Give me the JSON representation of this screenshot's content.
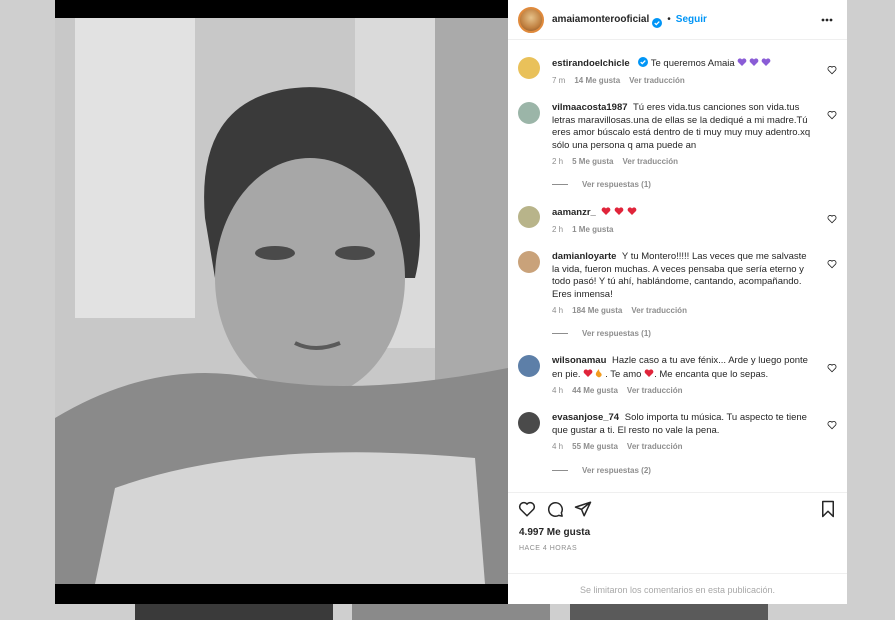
{
  "post": {
    "username": "amaiamonterooficial",
    "follow_label": "Seguir",
    "likes": "4.997 Me gusta",
    "timestamp": "HACE 4 HORAS",
    "comments_limited": "Se limitaron los comentarios en esta publicación."
  },
  "comments": [
    {
      "user": "estirandoelchicle",
      "verified": true,
      "text": "Te queremos Amaia",
      "time": "7 m",
      "likes": "14 Me gusta",
      "translate": "Ver traducción",
      "replies": "",
      "emoji": "purple-hearts",
      "avatar_color": "#e9c15a"
    },
    {
      "user": "vilmaacosta1987",
      "verified": false,
      "text": "Tú eres vida.tus canciones son vida.tus letras maravillosas.una de ellas se la dediqué a mi madre.Tú eres amor búscalo está dentro de ti muy muy muy adentro.xq sólo una persona q ama puede an",
      "time": "2 h",
      "likes": "5 Me gusta",
      "translate": "Ver traducción",
      "replies": "Ver respuestas (1)",
      "avatar_color": "#9bb5a8"
    },
    {
      "user": "aamanzr_",
      "verified": false,
      "text": "",
      "time": "2 h",
      "likes": "1 Me gusta",
      "translate": "",
      "replies": "",
      "emoji": "red-hearts",
      "avatar_color": "#b8b48a"
    },
    {
      "user": "damianloyarte",
      "verified": false,
      "text": "Y tu Montero!!!!! Las veces que me salvaste la vida, fueron muchas. A veces pensaba que sería eterno y todo pasó! Y tú ahí, hablándome, cantando, acompañando. Eres inmensa!",
      "time": "4 h",
      "likes": "184 Me gusta",
      "translate": "Ver traducción",
      "replies": "Ver respuestas (1)",
      "avatar_color": "#c9a27a"
    },
    {
      "user": "wilsonamau",
      "verified": false,
      "text_before": "Hazle caso a tu ave fénix... Arde y luego ponte en pie.",
      "text_mid": ". Te amo",
      "text_after": ". Me encanta que lo sepas.",
      "time": "4 h",
      "likes": "44 Me gusta",
      "translate": "Ver traducción",
      "replies": "",
      "avatar_color": "#5d7fa8"
    },
    {
      "user": "evasanjose_74",
      "verified": false,
      "text": "Solo importa tu música. Tu aspecto te tiene que gustar a ti. El resto no vale la pena.",
      "time": "4 h",
      "likes": "55 Me gusta",
      "translate": "Ver traducción",
      "replies": "Ver respuestas (2)",
      "avatar_color": "#4a4a4a"
    }
  ],
  "colors": {
    "accent": "#0095f6",
    "heart_red": "#e0243a",
    "purple": "#8a5cd6"
  },
  "icons": [
    "more-options-icon",
    "like-icon",
    "comment-icon",
    "share-icon",
    "save-icon",
    "verified-icon",
    "heart-icon"
  ]
}
